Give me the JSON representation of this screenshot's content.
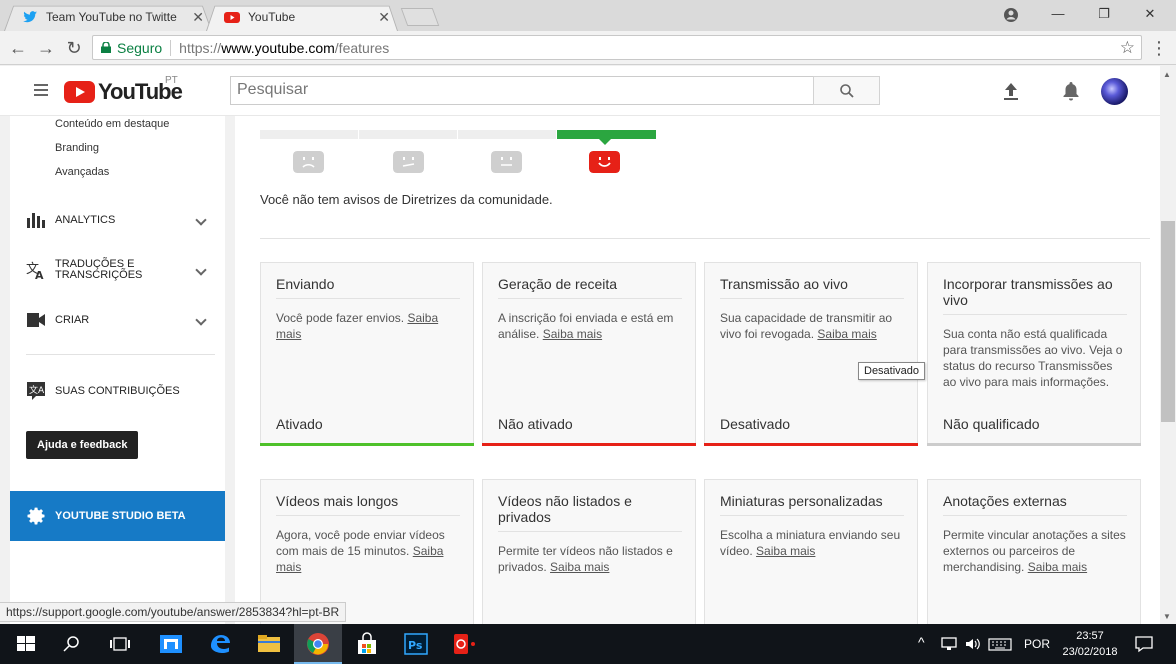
{
  "browser": {
    "tabs": [
      {
        "title": "Team YouTube no Twitte",
        "icon": "twitter-bird-icon",
        "active": false
      },
      {
        "title": "YouTube",
        "icon": "youtube-icon",
        "active": true
      }
    ],
    "secure_label": "Seguro",
    "url_scheme": "https://",
    "url_host": "www.youtube.com",
    "url_path": "/features",
    "status_url": "https://support.google.com/youtube/answer/2853834?hl=pt-BR"
  },
  "header": {
    "logo_text": "YouTube",
    "country_code": "PT",
    "search_placeholder": "Pesquisar"
  },
  "sidebar": {
    "sub_items": [
      "Conteúdo em destaque",
      "Branding",
      "Avançadas"
    ],
    "analytics": "ANALYTICS",
    "translations_line1": "TRADUÇÕES E",
    "translations_line2": "TRANSCRIÇÕES",
    "create": "CRIAR",
    "contributions": "SUAS CONTRIBUIÇÕES",
    "help": "Ajuda e feedback",
    "studio": "YOUTUBE STUDIO BETA"
  },
  "main": {
    "guidelines_text": "Você não tem avisos de Diretrizes da comunidade.",
    "cards_row1": [
      {
        "title": "Enviando",
        "desc": "Você pode fazer envios.",
        "link": "Saiba mais",
        "status": "Ativado",
        "bar_color": "#4ec12a"
      },
      {
        "title": "Geração de receita",
        "desc": "A inscrição foi enviada e está em análise.",
        "link": "Saiba mais",
        "status": "Não ativado",
        "bar_color": "#e62117"
      },
      {
        "title": "Transmissão ao vivo",
        "desc": "Sua capacidade de transmitir ao vivo foi revogada.",
        "link": "Saiba mais",
        "status": "Desativado",
        "bar_color": "#e62117"
      },
      {
        "title": "Incorporar transmissões ao vivo",
        "desc": "Sua conta não está qualificada para transmissões ao vivo. Veja o status do recurso Transmissões ao vivo para mais informações.",
        "link": "",
        "status": "Não qualificado",
        "bar_color": "#cccccc"
      }
    ],
    "cards_row2": [
      {
        "title": "Vídeos mais longos",
        "desc": "Agora, você pode enviar vídeos com mais de 15 minutos.",
        "link": "Saiba mais"
      },
      {
        "title": "Vídeos não listados e privados",
        "desc": "Permite ter vídeos não listados e privados.",
        "link": "Saiba mais"
      },
      {
        "title": "Miniaturas personalizadas",
        "desc": "Escolha a miniatura enviando seu vídeo.",
        "link": "Saiba mais"
      },
      {
        "title": "Anotações externas",
        "desc": "Permite vincular anotações a sites externos ou parceiros de merchandising.",
        "link": "Saiba mais"
      }
    ],
    "tooltip": "Desativado"
  },
  "taskbar": {
    "language": "POR",
    "time": "23:57",
    "date": "23/02/2018"
  },
  "colors": {
    "yt_red": "#e62117",
    "studio_blue": "#167ac6",
    "active_green": "#4ec12a"
  }
}
